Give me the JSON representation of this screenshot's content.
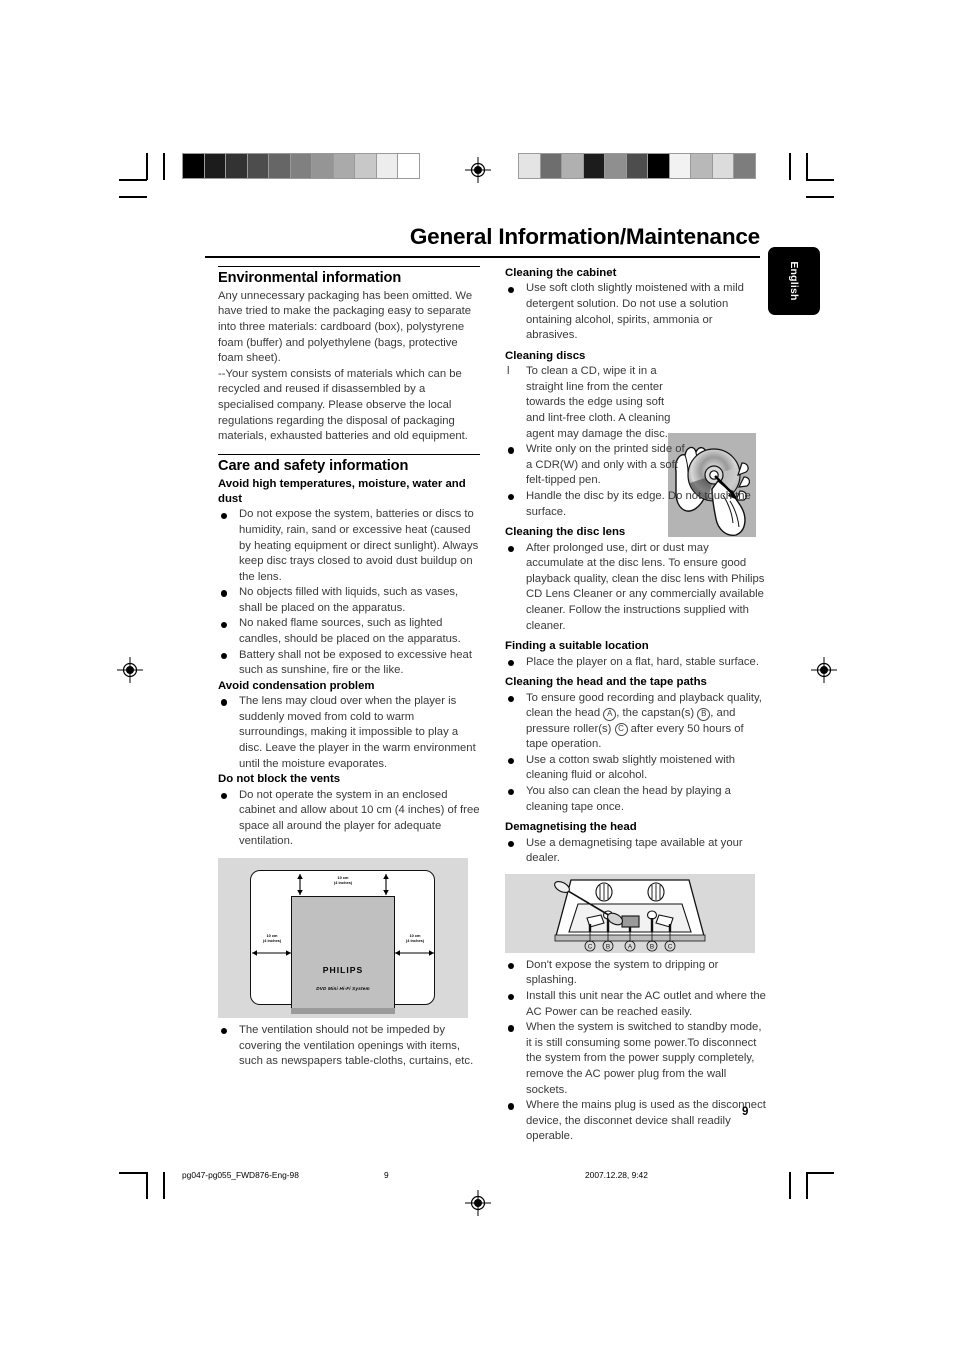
{
  "header": {
    "title": "General Information/Maintenance",
    "language_tab": "English"
  },
  "print_marks": {
    "colorbar_left": [
      "#000000",
      "#1c1c1c",
      "#333333",
      "#4d4d4d",
      "#666666",
      "#808080",
      "#959595",
      "#aaaaaa",
      "#c8c8c8",
      "#ededed",
      "#ffffff"
    ],
    "colorbar_right": [
      "#e4e4e4",
      "#6e6e6e",
      "#b0b0b0",
      "#1c1c1c",
      "#8f8f8f",
      "#4d4d4d",
      "#000000",
      "#f2f2f2",
      "#b8b8b8",
      "#dcdcdc",
      "#7d7d7d"
    ]
  },
  "left_column": {
    "environmental": {
      "heading": "Environmental information",
      "paragraph": "Any unnecessary packaging has been omitted. We have tried to make the packaging easy to separate into three materials: cardboard (box), polystyrene foam (buffer) and polyethylene (bags, protective foam sheet).",
      "paragraph2": "--Your system consists of materials which can be recycled and reused if disassembled by a specialised company. Please observe the local regulations regarding the disposal of packaging materials, exhausted batteries and old equipment."
    },
    "care": {
      "heading": "Care and safety information",
      "sub1": "Avoid high temperatures, moisture, water and dust",
      "bullets1": [
        "Do not expose the system, batteries or discs to humidity, rain, sand or excessive heat (caused by heating equipment or direct sunlight). Always keep disc trays closed to avoid dust buildup on the lens.",
        "No objects filled with liquids, such as vases, shall be placed on the apparatus.",
        "No naked flame sources, such as lighted candles, should be placed on the apparatus.",
        "Battery shall not be exposed to excessive heat such as sunshine, fire or the like."
      ],
      "sub2": "Avoid condensation problem",
      "bullets2": [
        "The lens may cloud over when the player is suddenly moved from cold to warm surroundings, making it impossible to play a disc. Leave the player in the warm environment until the moisture evaporates."
      ],
      "sub3": "Do not block the vents",
      "bullets3": [
        "Do not operate the system in an enclosed cabinet and allow about 10 cm (4 inches) of free space all around the player for adequate ventilation."
      ],
      "bullets4": [
        "The ventilation should not be impeded by covering the ventilation openings with items, such as newspapers table-cloths, curtains, etc."
      ]
    },
    "vent_figure": {
      "brand": "PHILIPS",
      "model": "DVD Mini Hi-Fi System",
      "dim_top_line1": "10 cm",
      "dim_top_line2": "(4 inches)",
      "dim_left_line1": "10 cm",
      "dim_left_line2": "(4 inches)",
      "dim_right_line1": "10 cm",
      "dim_right_line2": "(4 inches)"
    }
  },
  "right_column": {
    "cabinet": {
      "heading": "Cleaning the cabinet",
      "bullets": [
        "Use soft cloth slightly moistened with a mild detergent solution. Do not use a solution ontaining alcohol, spirits, ammonia or abrasives."
      ]
    },
    "discs": {
      "heading": "Cleaning discs",
      "item_marker": "l",
      "item1": "To clean a CD, wipe it in a straight line from the center towards the edge using soft and lint-free cloth. A cleaning agent may damage the disc.",
      "bullets": [
        "Write only on the printed side of a CDR(W) and only with a soft felt-tipped pen.",
        "Handle the disc by its edge. Do not touch the surface."
      ]
    },
    "lens": {
      "heading": "Cleaning the disc lens",
      "bullets": [
        "After prolonged use, dirt or dust may accumulate at the disc lens. To ensure good playback quality, clean the disc lens with Philips CD Lens Cleaner or any commercially available cleaner. Follow the instructions supplied with cleaner."
      ]
    },
    "location": {
      "heading": "Finding a suitable location",
      "bullets": [
        "Place the player on a flat, hard, stable surface."
      ]
    },
    "tape_paths": {
      "heading": "Cleaning the head and the tape paths",
      "bullet1_pre": "To ensure good recording and playback quality, clean the head ",
      "bullet1_a": "A",
      "bullet1_mid1": ", the capstan(s) ",
      "bullet1_b": "B",
      "bullet1_mid2": ", and pressure roller(s) ",
      "bullet1_c": "C",
      "bullet1_post": " after every 50 hours of tape operation.",
      "bullets": [
        "Use a cotton swab slightly moistened with cleaning fluid or alcohol.",
        "You also can clean the head  by playing a cleaning tape once."
      ]
    },
    "demag": {
      "heading": "Demagnetising the head",
      "bullets": [
        "Use a demagnetising tape available at your dealer."
      ]
    },
    "tape_figure": {
      "labels": [
        "C",
        "B",
        "A",
        "B",
        "C"
      ]
    },
    "final_bullets": [
      "Don't expose the system to dripping or splashing.",
      "Install this unit near the AC outlet and where the AC Power can be reached easily.",
      "When the system is switched to standby mode, it is still consuming some power.To disconnect the system from the power supply completely, remove the AC power plug from the wall sockets.",
      "Where the mains plug is used as the disconnect device, the disconnet device shall readily operable."
    ],
    "page_number": "9"
  },
  "footer": {
    "filename": "pg047-pg055_FWD876-Eng-98",
    "page": "9",
    "timestamp": "2007.12.28, 9:42"
  }
}
